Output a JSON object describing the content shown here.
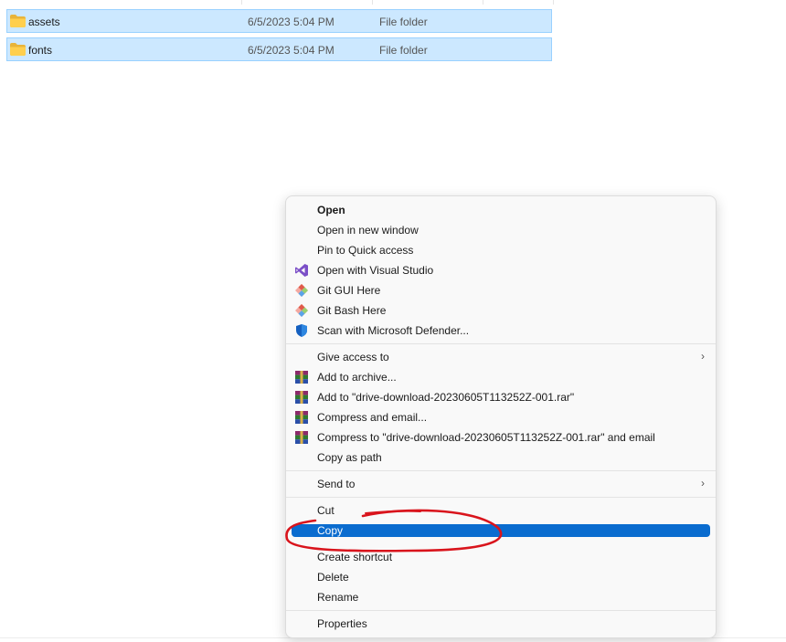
{
  "files": [
    {
      "name": "assets",
      "date": "6/5/2023 5:04 PM",
      "type": "File folder"
    },
    {
      "name": "fonts",
      "date": "6/5/2023 5:04 PM",
      "type": "File folder"
    }
  ],
  "menu": {
    "open": "Open",
    "open_new_window": "Open in new window",
    "pin_quick_access": "Pin to Quick access",
    "open_visual_studio": "Open with Visual Studio",
    "git_gui": "Git GUI Here",
    "git_bash": "Git Bash Here",
    "scan_defender": "Scan with Microsoft Defender...",
    "give_access": "Give access to",
    "add_archive": "Add to archive...",
    "add_to_rar": "Add to \"drive-download-20230605T113252Z-001.rar\"",
    "compress_email": "Compress and email...",
    "compress_rar_email": "Compress to \"drive-download-20230605T113252Z-001.rar\" and email",
    "copy_path": "Copy as path",
    "send_to": "Send to",
    "cut": "Cut",
    "copy": "Copy",
    "create_shortcut": "Create shortcut",
    "delete": "Delete",
    "rename": "Rename",
    "properties": "Properties"
  },
  "colors": {
    "selection_bg": "#cce8ff",
    "menu_highlight": "#0a6ccf",
    "annotation": "#d9141c"
  }
}
